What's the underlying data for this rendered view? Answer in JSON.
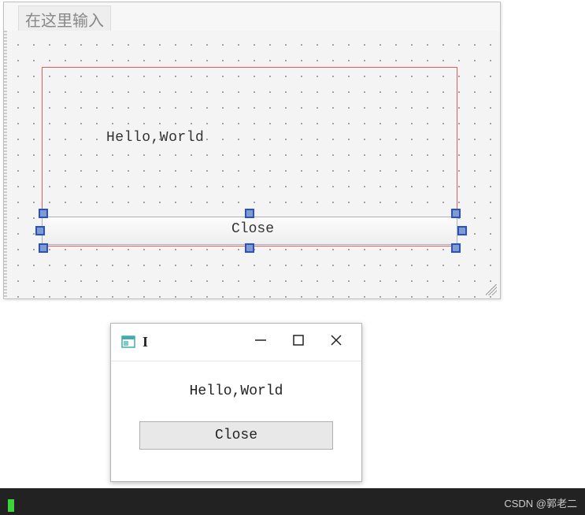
{
  "designer": {
    "tab_placeholder": "在这里输入",
    "label_text": "Hello,World",
    "button_text": "Close"
  },
  "runtime": {
    "title": "",
    "label_text": "Hello,World",
    "button_text": "Close"
  },
  "icons": {
    "app_icon": "app-icon",
    "minimize": "minimize-icon",
    "maximize": "maximize-icon",
    "close": "close-icon"
  },
  "watermark": "CSDN @郭老二"
}
